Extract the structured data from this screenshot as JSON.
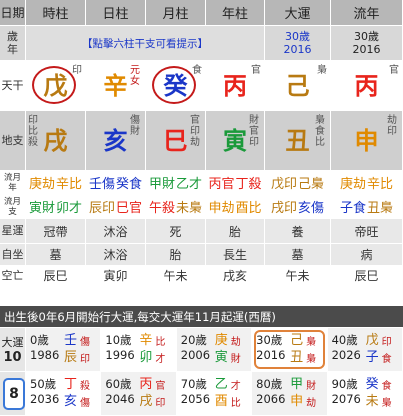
{
  "colors": {
    "wood": "#1a9a3a",
    "fire": "#e8241c",
    "earth": "#b87a12",
    "metal": "#e08a00",
    "water": "#1a36c8",
    "highlight": "#c41a1a",
    "current_luck": "#e0823a"
  },
  "header": {
    "row_label": "日期",
    "cols": [
      "時柱",
      "日柱",
      "月柱",
      "年柱",
      "大運",
      "流年"
    ]
  },
  "age_row": {
    "label": "歲年",
    "hint": "【點擊六柱干支可看提示】",
    "luck_age": "30歲",
    "luck_year": "2016",
    "flow_age": "30歲",
    "flow_year": "2016"
  },
  "stem_row": {
    "label": "天干",
    "hour": {
      "char": "戊",
      "god": "印"
    },
    "day": {
      "char": "辛",
      "note": "元女"
    },
    "month": {
      "char": "癸",
      "god": "食"
    },
    "year": {
      "char": "丙",
      "god": "官"
    },
    "luck": {
      "char": "己",
      "god": "梟"
    },
    "flow": {
      "char": "丙",
      "god": "官"
    }
  },
  "branch_row": {
    "label": "地支",
    "hour": {
      "char": "戌",
      "gods": "印比殺"
    },
    "day": {
      "char": "亥",
      "gods": "傷財"
    },
    "month": {
      "char": "巳",
      "gods": "官印劫"
    },
    "year": {
      "char": "寅",
      "gods": "財官印"
    },
    "luck": {
      "char": "丑",
      "gods": "梟食比"
    },
    "flow": {
      "char": "申",
      "gods": "劫印"
    }
  },
  "flow_month": {
    "label": "流月年",
    "cells": [
      [
        "庚劫",
        "辛比"
      ],
      [
        "壬傷",
        "癸食"
      ],
      [
        "甲財",
        "乙才"
      ],
      [
        "丙官",
        "丁殺"
      ],
      [
        "戊印",
        "己梟"
      ],
      [
        "庚劫",
        "辛比"
      ]
    ]
  },
  "flow_day": {
    "label": "流月支",
    "cells": [
      [
        "寅財",
        "卯才"
      ],
      [
        "辰印",
        "巳官"
      ],
      [
        "午殺",
        "未梟"
      ],
      [
        "申劫",
        "酉比"
      ],
      [
        "戌印",
        "亥傷"
      ],
      [
        "子食",
        "丑梟"
      ]
    ]
  },
  "star_row": {
    "label": "星運",
    "values": [
      "冠帶",
      "沐浴",
      "死",
      "胎",
      "養",
      "帝旺"
    ]
  },
  "self_row": {
    "label": "自坐",
    "values": [
      "墓",
      "沐浴",
      "胎",
      "長生",
      "墓",
      "病"
    ]
  },
  "void_row": {
    "label": "空亡",
    "values": [
      "辰巳",
      "寅卯",
      "午未",
      "戌亥",
      "午未",
      "辰巳"
    ]
  },
  "banner": "出生後0年6月開始行大運,每交大運年11月起運(西曆)",
  "luck_pillars": {
    "label_top": "大運",
    "label_top_num": "10",
    "page": "8",
    "row1": [
      {
        "age": "0歲",
        "year": "1986",
        "stem": "壬",
        "branch": "辰",
        "s1": "傷",
        "s2": "印"
      },
      {
        "age": "10歲",
        "year": "1996",
        "stem": "辛",
        "branch": "卯",
        "s1": "比",
        "s2": "才"
      },
      {
        "age": "20歲",
        "year": "2006",
        "stem": "庚",
        "branch": "寅",
        "s1": "劫",
        "s2": "財"
      },
      {
        "age": "30歲",
        "year": "2016",
        "stem": "己",
        "branch": "丑",
        "s1": "梟",
        "s2": "梟"
      },
      {
        "age": "40歲",
        "year": "2026",
        "stem": "戊",
        "branch": "子",
        "s1": "印",
        "s2": "食"
      }
    ],
    "row2": [
      {
        "age": "50歲",
        "year": "2036",
        "stem": "丁",
        "branch": "亥",
        "s1": "殺",
        "s2": "傷"
      },
      {
        "age": "60歲",
        "year": "2046",
        "stem": "丙",
        "branch": "戌",
        "s1": "官",
        "s2": "印"
      },
      {
        "age": "70歲",
        "year": "2056",
        "stem": "乙",
        "branch": "酉",
        "s1": "才",
        "s2": "比"
      },
      {
        "age": "80歲",
        "year": "2066",
        "stem": "甲",
        "branch": "申",
        "s1": "財",
        "s2": "劫"
      },
      {
        "age": "90歲",
        "year": "2076",
        "stem": "癸",
        "branch": "未",
        "s1": "食",
        "s2": "梟"
      }
    ]
  }
}
